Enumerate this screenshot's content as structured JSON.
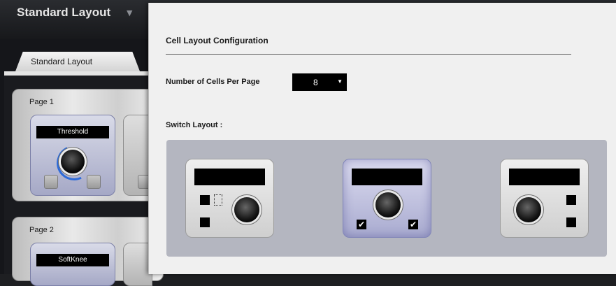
{
  "app": {
    "layout_menu_label": "Standard Layout",
    "tab_label": "Standard Layout"
  },
  "pages": [
    {
      "label": "Page 1",
      "cell_name": "Threshold"
    },
    {
      "label": "Page 2",
      "cell_name": "SoftKnee"
    }
  ],
  "dialog": {
    "title": "Cell Layout Configuration",
    "cells_label": "Number of Cells Per Page",
    "cells_value": "8",
    "switch_label": "Switch Layout :",
    "layouts": [
      {
        "name": "layout-option-1",
        "selected": false
      },
      {
        "name": "layout-option-2",
        "selected": true
      },
      {
        "name": "layout-option-3",
        "selected": false
      }
    ],
    "check_glyph": "✔"
  },
  "colors": {
    "accent_blue": "#2e6bd8",
    "selected_layout": "#a9abd0"
  }
}
